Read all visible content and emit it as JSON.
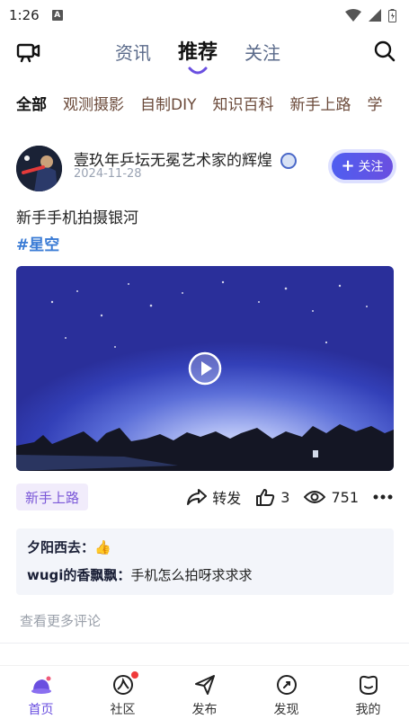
{
  "status": {
    "time": "1:26",
    "notif_icon": "A"
  },
  "nav": {
    "tabs": [
      {
        "label": "资讯",
        "active": false
      },
      {
        "label": "推荐",
        "active": true
      },
      {
        "label": "关注",
        "active": false
      }
    ]
  },
  "categories": [
    "全部",
    "观测摄影",
    "自制DIY",
    "知识百科",
    "新手上路",
    "学"
  ],
  "post": {
    "user": "壹玖年乒坛无冕艺术家的辉煌",
    "date": "2024-11-28",
    "follow_label": "关注",
    "title": "新手手机拍摄银河",
    "tag": "#星空",
    "topic": "新手上路",
    "share_label": "转发",
    "likes": "3",
    "views": "751",
    "comments": [
      {
        "user": "夕阳西去",
        "separator": "：",
        "text": "👍"
      },
      {
        "user": "wugi的香飘飘",
        "separator": "：",
        "text": "手机怎么拍呀求求求"
      }
    ],
    "more_comments": "查看更多评论"
  },
  "bottom_nav": [
    {
      "label": "首页",
      "icon": "home-planet-icon",
      "active": true
    },
    {
      "label": "社区",
      "icon": "community-icon",
      "active": false,
      "dot": true
    },
    {
      "label": "发布",
      "icon": "publish-icon",
      "active": false
    },
    {
      "label": "发现",
      "icon": "discover-icon",
      "active": false
    },
    {
      "label": "我的",
      "icon": "profile-icon",
      "active": false
    }
  ],
  "colors": {
    "accent": "#6a4fe0",
    "tag": "#3a7bd5",
    "topic_bg": "#f1ecfb"
  }
}
